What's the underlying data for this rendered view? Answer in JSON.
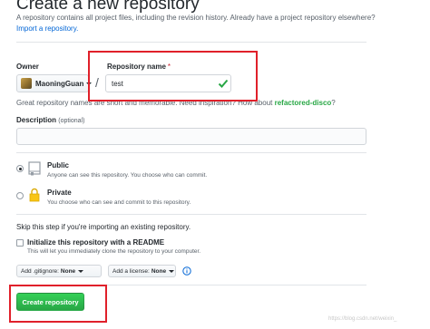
{
  "header": {
    "title": "Create a new repository",
    "subtitle": "A repository contains all project files, including the revision history. Already have a project repository elsewhere?",
    "import_link": "Import a repository."
  },
  "owner": {
    "label": "Owner",
    "name": "MaoningGuan",
    "avatar_icon": "user-avatar"
  },
  "repo": {
    "label": "Repository name",
    "required_marker": "*",
    "separator": "/",
    "value": "test",
    "valid_icon": "check-icon"
  },
  "hint": {
    "text": "Great repository names are short and memorable. Need inspiration? How about",
    "suggestion": "refactored-disco",
    "suffix": "?"
  },
  "description": {
    "label": "Description",
    "optional": "(optional)",
    "value": ""
  },
  "visibility": {
    "options": [
      {
        "title": "Public",
        "desc": "Anyone can see this repository. You choose who can commit.",
        "selected": true,
        "icon": "repo-icon"
      },
      {
        "title": "Private",
        "desc": "You choose who can see and commit to this repository.",
        "selected": false,
        "icon": "lock-icon"
      }
    ]
  },
  "skip_text": "Skip this step if you're importing an existing repository.",
  "readme": {
    "label": "Initialize this repository with a README",
    "desc": "This will let you immediately clone the repository to your computer.",
    "checked": false
  },
  "gitignore": {
    "prefix": "Add .gitignore:",
    "value": "None"
  },
  "license": {
    "prefix": "Add a license:",
    "value": "None"
  },
  "create_button": "Create repository",
  "watermark": "https://blog.csdn.net/weixin_",
  "colors": {
    "accent_green": "#28a745",
    "link_blue": "#0366d6",
    "annotation_red": "#e0202a"
  }
}
